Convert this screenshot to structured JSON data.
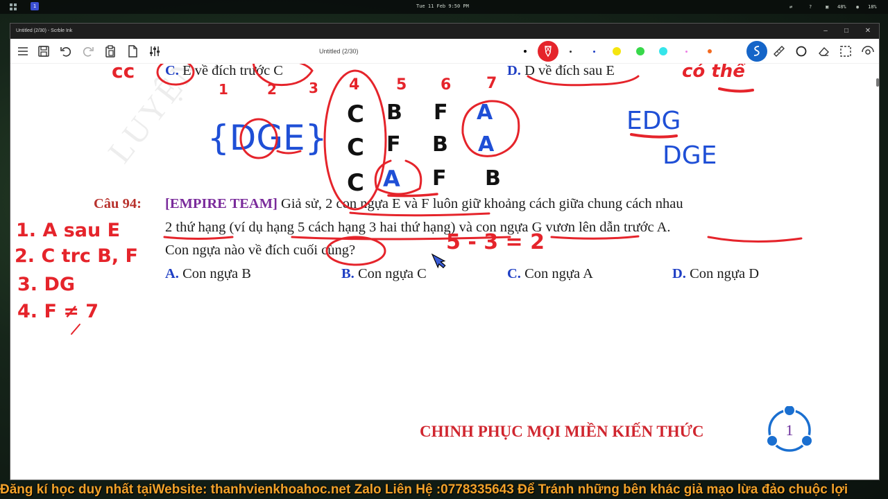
{
  "system_bar": {
    "workspace": "1",
    "clock": "Tue 11 Feb 9:50 PM",
    "tray": {
      "battery": "48%",
      "volume": "18%"
    }
  },
  "window": {
    "title": "Untitled (2/30) - Scrble Ink",
    "controls": [
      "minimize-icon",
      "maximize-icon",
      "close-icon"
    ]
  },
  "toolbar": {
    "doc_title": "Untitled (2/30)",
    "left_tools": [
      "menu-icon",
      "save-icon",
      "undo-icon",
      "redo-icon",
      "paste-icon",
      "page-icon",
      "settings-sliders-icon"
    ],
    "pen_colors": [
      "#000000",
      "#e5242b",
      "#333333",
      "#1f3fc4",
      "#f5e50f",
      "#38d84a",
      "#35e5ea",
      "#ee7fe6",
      "#f36b21"
    ],
    "active_pen_color": "#e5242b",
    "right_tools": [
      "active-pen-icon",
      "ruler-icon",
      "circle-shape-icon",
      "eraser-icon",
      "selection-icon",
      "view-icon"
    ]
  },
  "document": {
    "prev_options": {
      "c_letter": "C.",
      "c_text": "E về đích trước C",
      "d_letter": "D.",
      "d_text": "D về đích sau E"
    },
    "question": {
      "label": "Câu 94:",
      "team": "[EMPIRE TEAM]",
      "line1": "Giả sử, 2 con ngựa E và F luôn giữ khoảng cách giữa chung cách nhau",
      "line2": "2 thứ hạng (ví dụ hạng 5 cách hạng 3 hai thứ hạng) và con ngựa G vươn lên dẫn trước A.",
      "line3": "Con ngựa nào về đích cuối cùng?"
    },
    "options": [
      {
        "letter": "A.",
        "text": "Con ngựa B"
      },
      {
        "letter": "B.",
        "text": "Con ngựa C"
      },
      {
        "letter": "C.",
        "text": "Con ngựa A"
      },
      {
        "letter": "D.",
        "text": "Con ngựa D"
      }
    ],
    "watermark": "LUYỆN THI",
    "footer_slogan": "CHINH PHỤC MỌI MIỀN KIẾN THỨC",
    "page_number": "1"
  },
  "handwriting": {
    "top_left_fragment": "cc",
    "column_numbers": [
      "1",
      "2",
      "3",
      "4",
      "5",
      "6",
      "7"
    ],
    "table_rows": [
      [
        "C",
        "B",
        "F",
        "A"
      ],
      [
        "C",
        "F",
        "B",
        "A"
      ],
      [
        "C",
        "A",
        "F",
        "B"
      ]
    ],
    "brace_set": "{DGE}",
    "maybe_note": "có thể",
    "right_seq_1": "EDG",
    "right_seq_2": "DGE",
    "calc": "5 - 3 = 2",
    "conditions": [
      "1. A sau E",
      "2. C trc B, F",
      "3. DG",
      "4. F ≠ 7"
    ]
  },
  "footer_banner": "Đăng kí học duy nhất tạiWebsite: thanhvienkhoahoc.net Zalo Liên Hệ :0778335643 Để Tránh những bên khác giả mạo lừa đảo chuộc lợi"
}
